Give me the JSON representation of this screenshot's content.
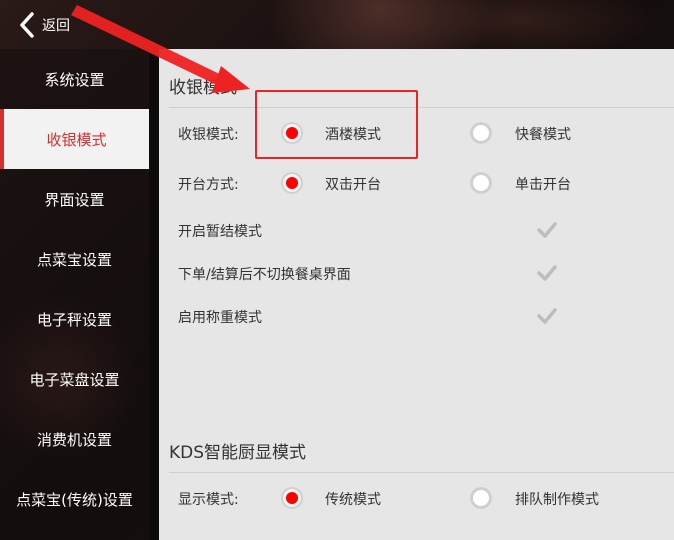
{
  "nav": {
    "back_label": "返回"
  },
  "sidebar": {
    "items": [
      {
        "label": "系统设置"
      },
      {
        "label": "收银模式"
      },
      {
        "label": "界面设置"
      },
      {
        "label": "点菜宝设置"
      },
      {
        "label": "电子秤设置"
      },
      {
        "label": "电子菜盘设置"
      },
      {
        "label": "消费机设置"
      },
      {
        "label": "点菜宝(传统)设置"
      }
    ],
    "active_index": 1
  },
  "section1": {
    "title": "收银模式",
    "cashier_mode": {
      "label": "收银模式:",
      "options": [
        "酒楼模式",
        "快餐模式"
      ],
      "selected": "酒楼模式"
    },
    "open_table": {
      "label": "开台方式:",
      "options": [
        "双击开台",
        "单击开台"
      ],
      "selected": "双击开台"
    },
    "checks": [
      {
        "label": "开启暂结模式"
      },
      {
        "label": "下单/结算后不切换餐桌界面"
      },
      {
        "label": "启用称重模式"
      }
    ]
  },
  "section2": {
    "title": "KDS智能厨显模式",
    "display_mode": {
      "label": "显示模式:",
      "options": [
        "传统模式",
        "排队制作模式"
      ],
      "selected": "传统模式"
    }
  },
  "colors": {
    "accent": "#d32f2f",
    "radio_on": "#ff0000",
    "annotation": "#ee2222"
  }
}
